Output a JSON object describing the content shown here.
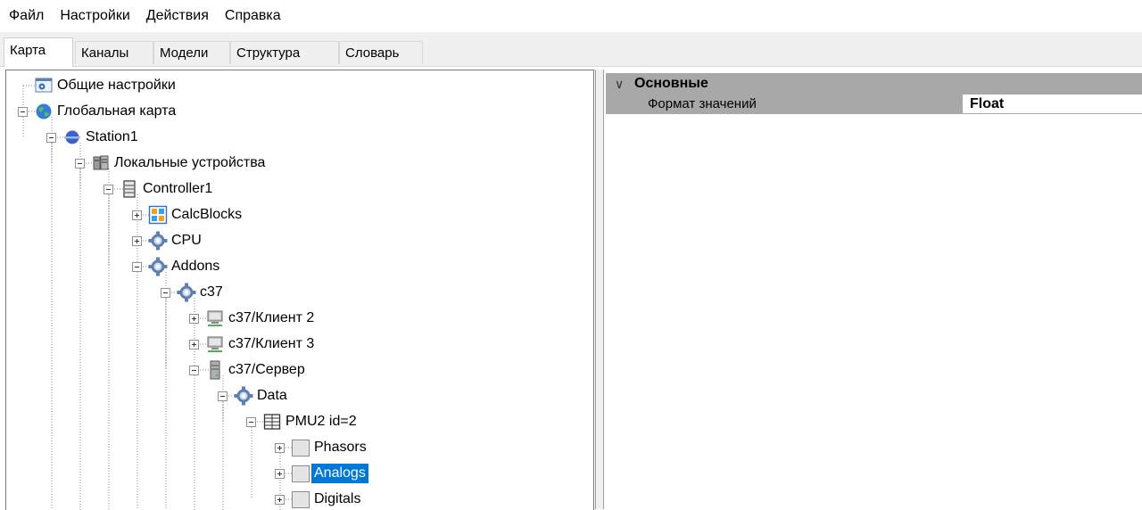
{
  "menu": {
    "items": [
      "Файл",
      "Настройки",
      "Действия",
      "Справка"
    ]
  },
  "tabs": [
    "Карта",
    "Каналы",
    "Модели",
    "Структура",
    "Словарь"
  ],
  "active_tab": "Карта",
  "tree": {
    "nodes": [
      {
        "label": "Общие настройки",
        "icon": "settings-window-icon",
        "expander": "none",
        "selected": false
      },
      {
        "label": "Глобальная карта",
        "icon": "globe-icon",
        "expander": "minus",
        "selected": false
      },
      {
        "label": "Station1",
        "icon": "station-icon",
        "expander": "minus",
        "selected": false
      },
      {
        "label": "Локальные устройства",
        "icon": "local-devices-icon",
        "expander": "minus",
        "selected": false
      },
      {
        "label": "Controller1",
        "icon": "controller-icon",
        "expander": "minus",
        "selected": false
      },
      {
        "label": "CalcBlocks",
        "icon": "calc-blocks-icon",
        "expander": "plus",
        "selected": false
      },
      {
        "label": "CPU",
        "icon": "gear-icon",
        "expander": "plus",
        "selected": false
      },
      {
        "label": "Addons",
        "icon": "gear-icon",
        "expander": "minus",
        "selected": false
      },
      {
        "label": "c37",
        "icon": "gear-icon",
        "expander": "minus",
        "selected": false
      },
      {
        "label": "c37/Клиент 2",
        "icon": "client-computer-icon",
        "expander": "plus",
        "selected": false
      },
      {
        "label": "c37/Клиент 3",
        "icon": "client-computer-icon",
        "expander": "plus",
        "selected": false
      },
      {
        "label": "c37/Сервер",
        "icon": "server-icon",
        "expander": "minus",
        "selected": false
      },
      {
        "label": "Data",
        "icon": "gear-icon",
        "expander": "minus",
        "selected": false
      },
      {
        "label": "PMU2 id=2",
        "icon": "table-icon",
        "expander": "minus",
        "selected": false
      },
      {
        "label": "Phasors",
        "icon": "folder-box-icon",
        "expander": "plus",
        "selected": false
      },
      {
        "label": "Analogs",
        "icon": "folder-box-icon",
        "expander": "plus",
        "selected": true
      },
      {
        "label": "Digitals",
        "icon": "folder-box-icon",
        "expander": "plus",
        "selected": false
      }
    ]
  },
  "properties": {
    "category": "Основные",
    "chevron_icon": "chevron-down-icon",
    "rows": [
      {
        "name": "Формат значений",
        "value": "Float"
      }
    ]
  },
  "colors": {
    "selection": "#0078d7",
    "category_bg": "#a8a8a8",
    "tab_bar_bg": "#f0f0f0"
  }
}
